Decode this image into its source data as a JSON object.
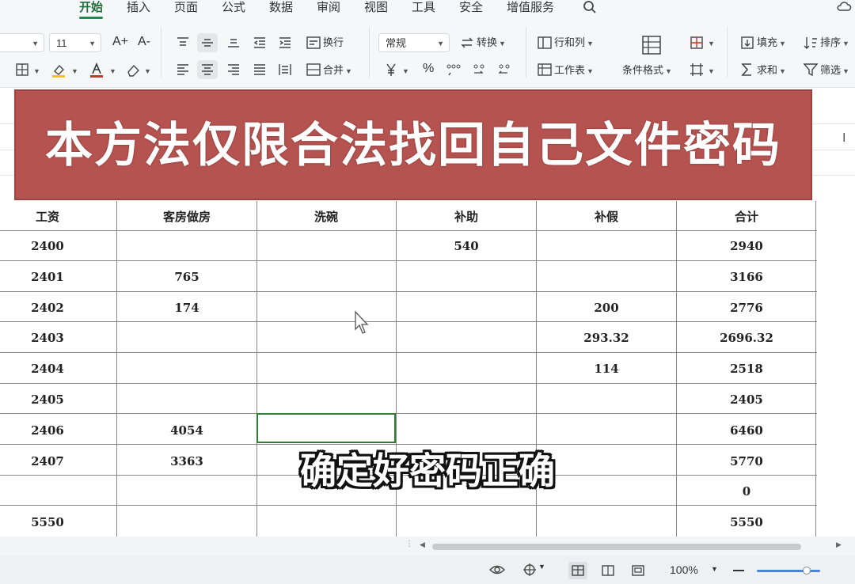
{
  "menu": {
    "tabs": [
      "开始",
      "插入",
      "页面",
      "公式",
      "数据",
      "审阅",
      "视图",
      "工具",
      "安全",
      "增值服务"
    ],
    "active_tab": "开始"
  },
  "toolbar": {
    "font_size": "11",
    "wrap_text": "换行",
    "number_format": "常规",
    "convert": "转换",
    "rows_cols": "行和列",
    "merge": "合并",
    "worksheet": "工作表",
    "cond_format": "条件格式",
    "fill": "填充",
    "sort": "排序",
    "sum": "求和",
    "filter": "筛选",
    "percent": "%",
    "font_grow": "A+",
    "font_shrink": "A-"
  },
  "banner": {
    "text": "本方法仅限合法找回自己文件密码"
  },
  "table": {
    "headers": [
      "工资",
      "客房做房",
      "洗碗",
      "补助",
      "补假",
      "合计"
    ],
    "rows": [
      [
        "2400",
        "",
        "",
        "540",
        "",
        "2940"
      ],
      [
        "2401",
        "765",
        "",
        "",
        "",
        "3166"
      ],
      [
        "2402",
        "174",
        "",
        "",
        "200",
        "2776"
      ],
      [
        "2403",
        "",
        "",
        "",
        "293.32",
        "2696.32"
      ],
      [
        "2404",
        "",
        "",
        "",
        "114",
        "2518"
      ],
      [
        "2405",
        "",
        "",
        "",
        "",
        "2405"
      ],
      [
        "2406",
        "4054",
        "",
        "",
        "",
        "6460"
      ],
      [
        "2407",
        "3363",
        "",
        "",
        "",
        "5770"
      ],
      [
        "",
        "",
        "",
        "",
        "",
        "0"
      ],
      [
        "5550",
        "",
        "",
        "",
        "",
        "5550"
      ]
    ]
  },
  "subtitle": {
    "text": "确定好密码正确"
  },
  "status": {
    "zoom": "100%"
  },
  "colors": {
    "accent": "#1f8a4c",
    "banner": "#b55350",
    "selection": "#2e7d32"
  }
}
